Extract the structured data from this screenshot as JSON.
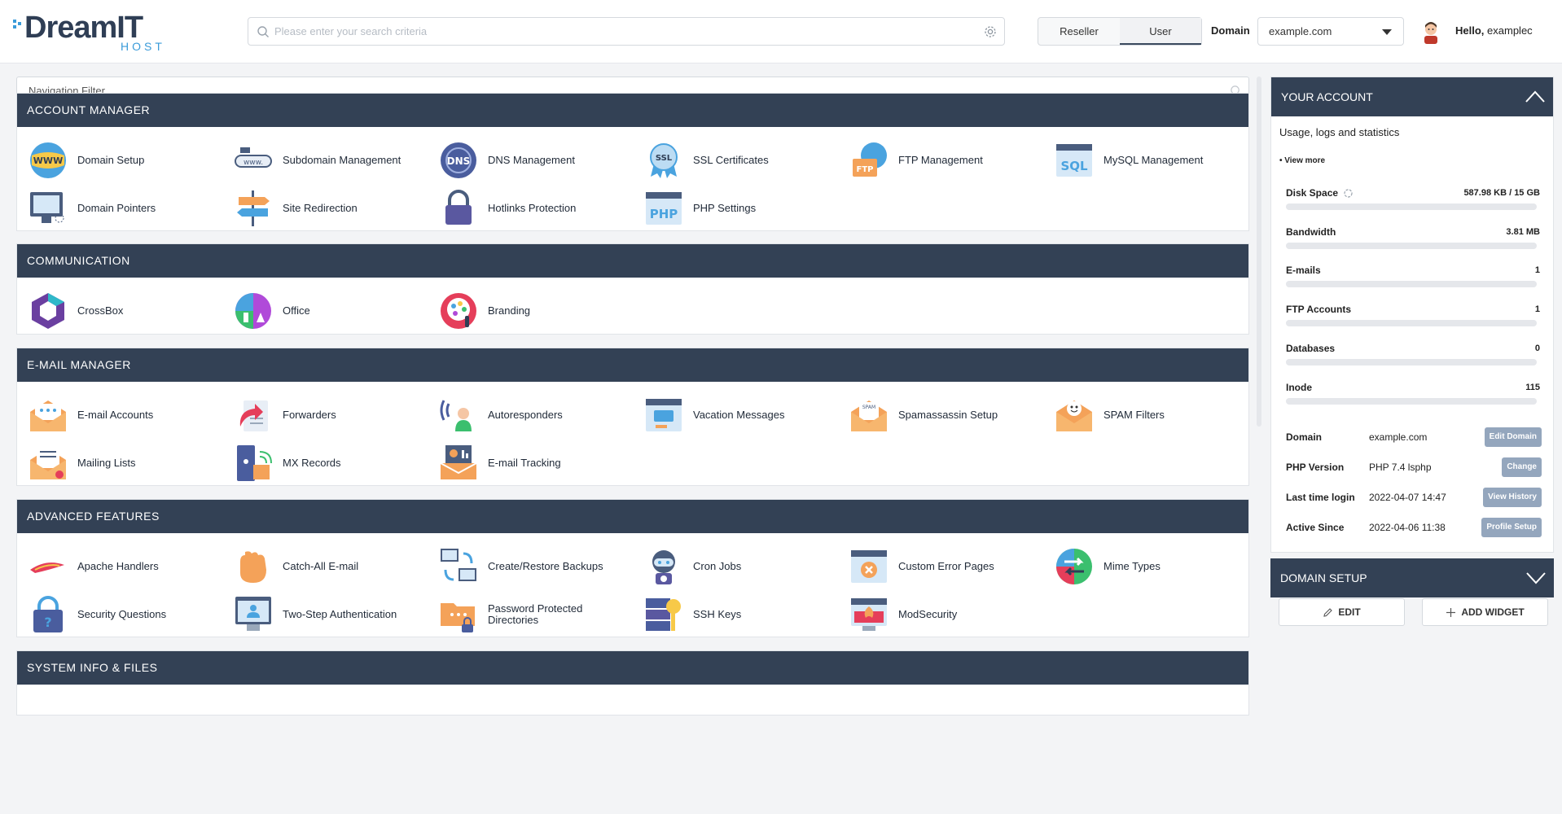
{
  "brand": {
    "name": "DreamIT",
    "sub": "HOST"
  },
  "search": {
    "placeholder": "Please enter your search criteria"
  },
  "roles": [
    "Reseller",
    "User"
  ],
  "domain_label": "Domain",
  "domain_value": "example.com",
  "greeting": {
    "prefix": "Hello,",
    "user": "examplec"
  },
  "nav_filter_placeholder": "Navigation Filter",
  "sections": [
    {
      "title": "ACCOUNT MANAGER",
      "items": [
        "Domain Setup",
        "Subdomain Management",
        "DNS Management",
        "SSL Certificates",
        "FTP Management",
        "MySQL Management",
        "Domain Pointers",
        "Site Redirection",
        "Hotlinks Protection",
        "PHP Settings"
      ]
    },
    {
      "title": "COMMUNICATION",
      "items": [
        "CrossBox",
        "Office",
        "Branding"
      ]
    },
    {
      "title": "E-MAIL MANAGER",
      "items": [
        "E-mail Accounts",
        "Forwarders",
        "Autoresponders",
        "Vacation Messages",
        "Spamassassin Setup",
        "SPAM Filters",
        "Mailing Lists",
        "MX Records",
        "E-mail Tracking"
      ]
    },
    {
      "title": "ADVANCED FEATURES",
      "items": [
        "Apache Handlers",
        "Catch-All E-mail",
        "Create/Restore Backups",
        "Cron Jobs",
        "Custom Error Pages",
        "Mime Types",
        "Security Questions",
        "Two-Step Authentication",
        "Password Protected Directories",
        "SSH Keys",
        "ModSecurity"
      ]
    },
    {
      "title": "SYSTEM INFO & FILES",
      "items": []
    }
  ],
  "account": {
    "title": "YOUR ACCOUNT",
    "subtitle": "Usage, logs and statistics",
    "view_more": "• View more",
    "stats": [
      {
        "name": "Disk Space",
        "value": "587.98 KB / 15 GB",
        "fraction": 0.0
      },
      {
        "name": "Bandwidth",
        "value": "3.81 MB",
        "fraction": 0.0
      },
      {
        "name": "E-mails",
        "value": "1",
        "fraction": 0.0
      },
      {
        "name": "FTP Accounts",
        "value": "1",
        "fraction": 0.0
      },
      {
        "name": "Databases",
        "value": "0",
        "fraction": 0.0
      },
      {
        "name": "Inode",
        "value": "115",
        "fraction": 0.0
      }
    ],
    "info": [
      {
        "key": "Domain",
        "value": "example.com",
        "button": "Edit Domain"
      },
      {
        "key": "PHP Version",
        "value": "PHP 7.4 lsphp",
        "button": "Change"
      },
      {
        "key": "Last time login",
        "value": "2022-04-07 14:47",
        "button": "View History"
      },
      {
        "key": "Active Since",
        "value": "2022-04-06 11:38",
        "button": "Profile Setup"
      }
    ]
  },
  "domain_setup_panel": {
    "title": "DOMAIN SETUP",
    "edit": "EDIT",
    "add_widget": "ADD WIDGET"
  },
  "colors": {
    "header": "#334155",
    "accent": "#3a9bd9",
    "button": "#94a6bd"
  },
  "icons": {
    "ACCOUNT MANAGER": [
      "globe-www-icon",
      "subdomain-icon",
      "dns-globe-icon",
      "ssl-badge-icon",
      "ftp-folder-icon",
      "sql-database-icon",
      "monitor-pointer-icon",
      "signpost-icon",
      "padlock-icon",
      "php-window-icon"
    ],
    "COMMUNICATION": [
      "crossbox-cube-icon",
      "office-icon",
      "palette-icon"
    ],
    "E-MAIL MANAGER": [
      "envelope-open-icon",
      "forward-arrow-icon",
      "autoresponder-person-icon",
      "chat-window-icon",
      "spam-envelope-icon",
      "smiley-envelope-icon",
      "mailing-list-icon",
      "server-mx-icon",
      "chart-envelope-icon"
    ],
    "ADVANCED FEATURES": [
      "feather-icon",
      "hand-icon",
      "backup-computers-icon",
      "robot-clock-icon",
      "error-window-icon",
      "transfer-arrows-icon",
      "question-lock-icon",
      "two-step-user-icon",
      "folder-lock-icon",
      "server-key-icon",
      "firewall-window-icon"
    ]
  }
}
